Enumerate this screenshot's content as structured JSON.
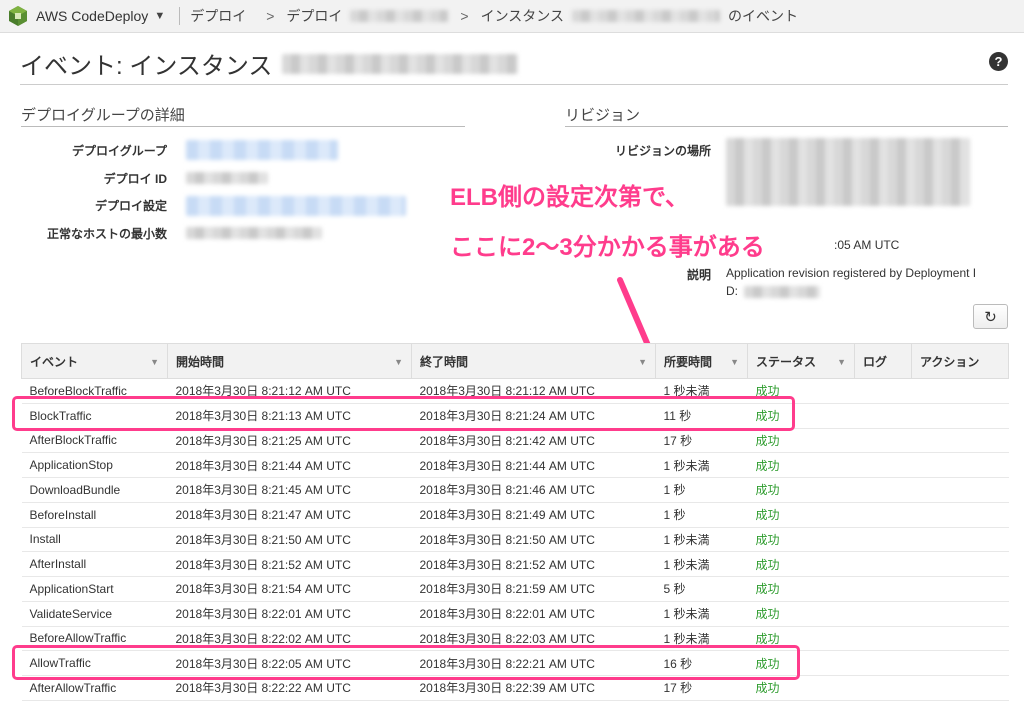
{
  "header": {
    "app_name": "AWS CodeDeploy",
    "breadcrumbs": [
      "デプロイ",
      "デプロイ",
      "インスタンス",
      "のイベント"
    ]
  },
  "page": {
    "title": "イベント: インスタンス"
  },
  "deploy_group_details": {
    "heading": "デプロイグループの詳細",
    "labels": [
      "デプロイグループ",
      "デプロイ ID",
      "デプロイ設定",
      "正常なホストの最小数"
    ]
  },
  "revision": {
    "heading": "リビジョン",
    "location_label": "リビジョンの場所",
    "time_partial": ":05 AM UTC",
    "description_label": "説明",
    "description_line1": "Application revision registered by Deployment I",
    "description_line2": "D:"
  },
  "annotation": {
    "line1": "ELB側の設定次第で、",
    "line2": "ここに2〜3分かかる事がある"
  },
  "table": {
    "columns": [
      "イベント",
      "開始時間",
      "終了時間",
      "所要時間",
      "ステータス",
      "ログ",
      "アクション"
    ],
    "rows": [
      {
        "event": "BeforeBlockTraffic",
        "start": "2018年3月30日 8:21:12 AM UTC",
        "end": "2018年3月30日 8:21:12 AM UTC",
        "duration": "1 秒未満",
        "status": "成功"
      },
      {
        "event": "BlockTraffic",
        "start": "2018年3月30日 8:21:13 AM UTC",
        "end": "2018年3月30日 8:21:24 AM UTC",
        "duration": "11 秒",
        "status": "成功"
      },
      {
        "event": "AfterBlockTraffic",
        "start": "2018年3月30日 8:21:25 AM UTC",
        "end": "2018年3月30日 8:21:42 AM UTC",
        "duration": "17 秒",
        "status": "成功"
      },
      {
        "event": "ApplicationStop",
        "start": "2018年3月30日 8:21:44 AM UTC",
        "end": "2018年3月30日 8:21:44 AM UTC",
        "duration": "1 秒未満",
        "status": "成功"
      },
      {
        "event": "DownloadBundle",
        "start": "2018年3月30日 8:21:45 AM UTC",
        "end": "2018年3月30日 8:21:46 AM UTC",
        "duration": "1 秒",
        "status": "成功"
      },
      {
        "event": "BeforeInstall",
        "start": "2018年3月30日 8:21:47 AM UTC",
        "end": "2018年3月30日 8:21:49 AM UTC",
        "duration": "1 秒",
        "status": "成功"
      },
      {
        "event": "Install",
        "start": "2018年3月30日 8:21:50 AM UTC",
        "end": "2018年3月30日 8:21:50 AM UTC",
        "duration": "1 秒未満",
        "status": "成功"
      },
      {
        "event": "AfterInstall",
        "start": "2018年3月30日 8:21:52 AM UTC",
        "end": "2018年3月30日 8:21:52 AM UTC",
        "duration": "1 秒未満",
        "status": "成功"
      },
      {
        "event": "ApplicationStart",
        "start": "2018年3月30日 8:21:54 AM UTC",
        "end": "2018年3月30日 8:21:59 AM UTC",
        "duration": "5 秒",
        "status": "成功"
      },
      {
        "event": "ValidateService",
        "start": "2018年3月30日 8:22:01 AM UTC",
        "end": "2018年3月30日 8:22:01 AM UTC",
        "duration": "1 秒未満",
        "status": "成功"
      },
      {
        "event": "BeforeAllowTraffic",
        "start": "2018年3月30日 8:22:02 AM UTC",
        "end": "2018年3月30日 8:22:03 AM UTC",
        "duration": "1 秒未満",
        "status": "成功"
      },
      {
        "event": "AllowTraffic",
        "start": "2018年3月30日 8:22:05 AM UTC",
        "end": "2018年3月30日 8:22:21 AM UTC",
        "duration": "16 秒",
        "status": "成功"
      },
      {
        "event": "AfterAllowTraffic",
        "start": "2018年3月30日 8:22:22 AM UTC",
        "end": "2018年3月30日 8:22:39 AM UTC",
        "duration": "17 秒",
        "status": "成功"
      }
    ]
  },
  "colors": {
    "highlight": "#ff3c8c",
    "success": "#2e9c2e"
  }
}
